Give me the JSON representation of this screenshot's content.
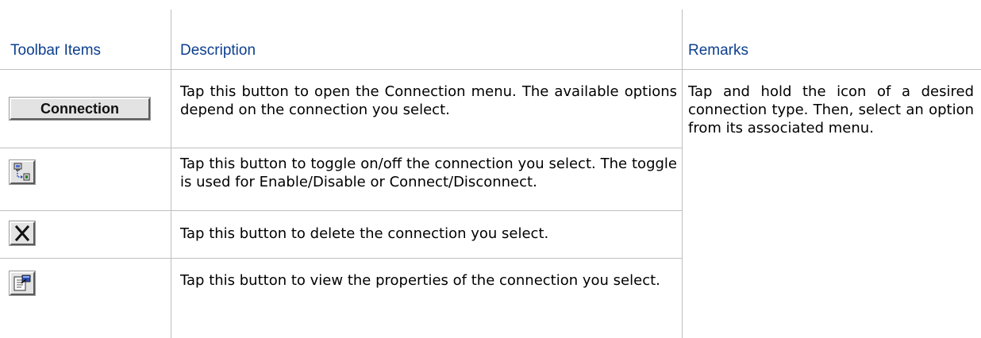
{
  "headers": {
    "toolbar_items": "Toolbar Items",
    "description": "Description",
    "remarks": "Remarks"
  },
  "rows": [
    {
      "item": "Connection",
      "icon": "connection-button",
      "description": "Tap this button to open the Connection menu. The available options depend on the connection you select."
    },
    {
      "icon": "toggle-connection-icon",
      "description": "Tap this button to toggle on/off the connection you select. The toggle is used for Enable/Disable or Connect/Disconnect."
    },
    {
      "icon": "delete-x-icon",
      "description": "Tap this button to delete the connection you select."
    },
    {
      "icon": "properties-icon",
      "description": "Tap this button to view the properties of the connection you select."
    }
  ],
  "remarks": "Tap and hold the icon of a desired connection type. Then, select an option from its associated menu.",
  "colors": {
    "header_text": "#0d3f8f",
    "grid": "#bfbfbf"
  }
}
